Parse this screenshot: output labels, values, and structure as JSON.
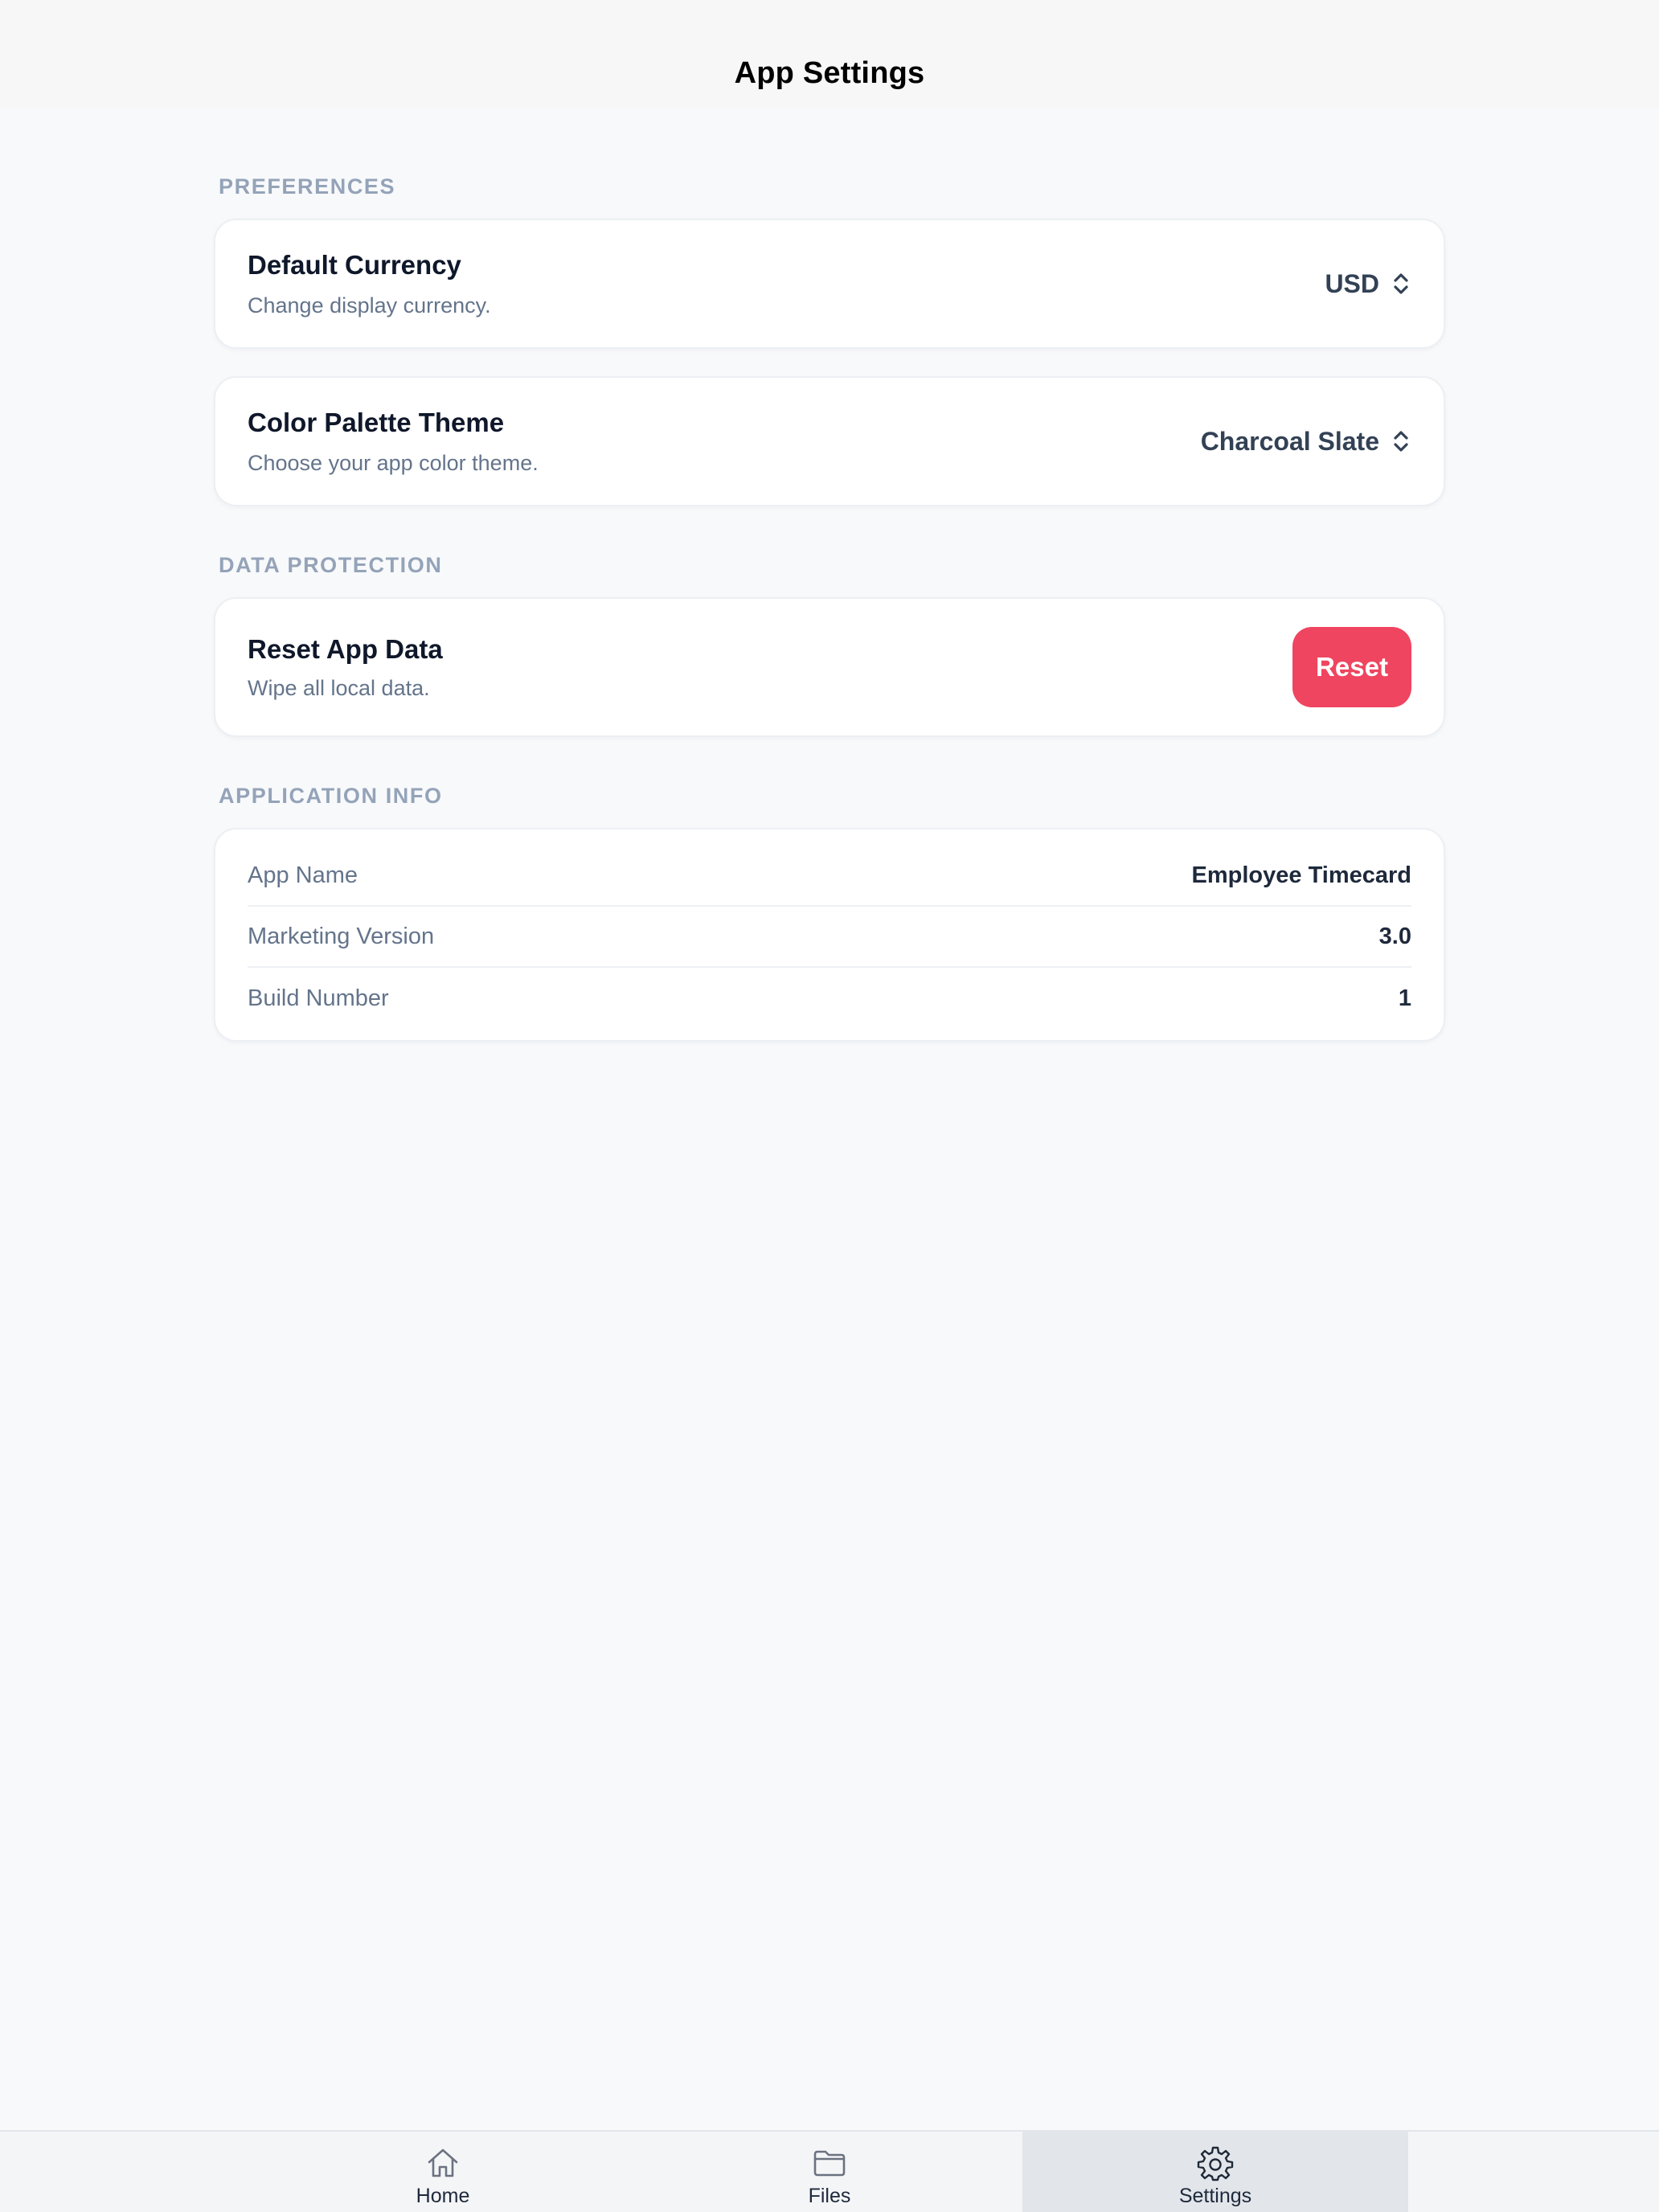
{
  "header": {
    "title": "App Settings"
  },
  "preferences": {
    "section_title": "PREFERENCES",
    "currency": {
      "title": "Default Currency",
      "subtitle": "Change display currency.",
      "value": "USD"
    },
    "theme": {
      "title": "Color Palette Theme",
      "subtitle": "Choose your app color theme.",
      "value": "Charcoal Slate"
    }
  },
  "data_protection": {
    "section_title": "DATA PROTECTION",
    "reset": {
      "title": "Reset App Data",
      "subtitle": "Wipe all local data.",
      "button_label": "Reset"
    }
  },
  "app_info": {
    "section_title": "APPLICATION INFO",
    "rows": [
      {
        "label": "App Name",
        "value": "Employee Timecard"
      },
      {
        "label": "Marketing Version",
        "value": "3.0"
      },
      {
        "label": "Build Number",
        "value": "1"
      }
    ]
  },
  "tabs": [
    {
      "label": "Home",
      "icon": "house-icon",
      "active": false
    },
    {
      "label": "Files",
      "icon": "folder-icon",
      "active": false
    },
    {
      "label": "Settings",
      "icon": "gear-icon",
      "active": true
    }
  ],
  "colors": {
    "accent_danger": "#ef4560",
    "section_header": "#94a3b8",
    "background": "#f8f9fb"
  }
}
